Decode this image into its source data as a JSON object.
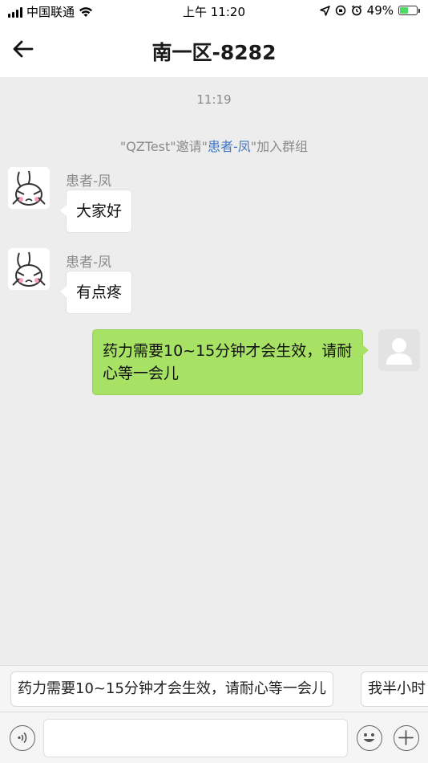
{
  "status_bar": {
    "carrier": "中国联通",
    "time": "上午 11:20",
    "battery_percent": "49%",
    "battery_level": 0.49
  },
  "nav": {
    "title": "南一区-8282",
    "back_icon": "arrow-left-icon"
  },
  "chat": {
    "time_label": "11:19",
    "system_message": {
      "prefix": "\"QZTest\"邀请\"",
      "highlight": "患者-凤",
      "suffix": "\"加入群组"
    },
    "messages": [
      {
        "sender": "患者-凤",
        "text": "大家好",
        "side": "left",
        "avatar": "bunny-avatar"
      },
      {
        "sender": "患者-凤",
        "text": "有点疼",
        "side": "left",
        "avatar": "bunny-avatar"
      },
      {
        "sender": "",
        "text": "药力需要10~15分钟才会生效，请耐心等一会儿",
        "side": "right",
        "avatar": "default-user-avatar"
      }
    ]
  },
  "quick_replies": [
    "药力需要10~15分钟才会生效，请耐心等一会儿",
    "我半小时"
  ],
  "input_bar": {
    "placeholder": "",
    "voice_icon": "voice-icon",
    "emoji_icon": "emoji-icon",
    "plus_icon": "plus-icon"
  },
  "colors": {
    "accent_link": "#3e76c5",
    "self_bubble": "#a7e264",
    "background": "#ededed"
  }
}
